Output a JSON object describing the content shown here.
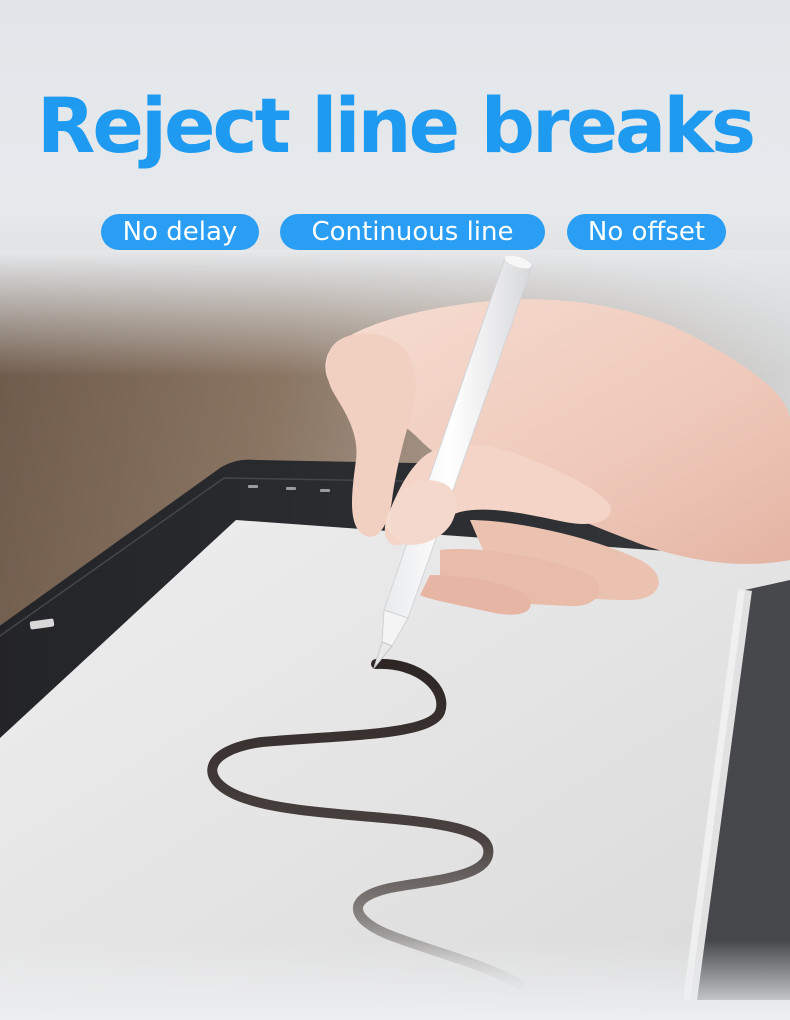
{
  "headline": "Reject line breaks",
  "features": [
    "No delay",
    "Continuous line",
    "No offset"
  ],
  "colors": {
    "accent": "#1e9bf0",
    "pill_background": "#2a9df4",
    "pill_text": "#ffffff",
    "tablet_frame": "#2a2b2e",
    "screen": "#e4e4e4",
    "stroke": "#3a3230"
  },
  "illustration": {
    "subject": "hand writing with white stylus pen on tablet",
    "icons": [
      "stylus-pen",
      "hand",
      "tablet",
      "ink-stroke",
      "wooden-desk"
    ]
  }
}
